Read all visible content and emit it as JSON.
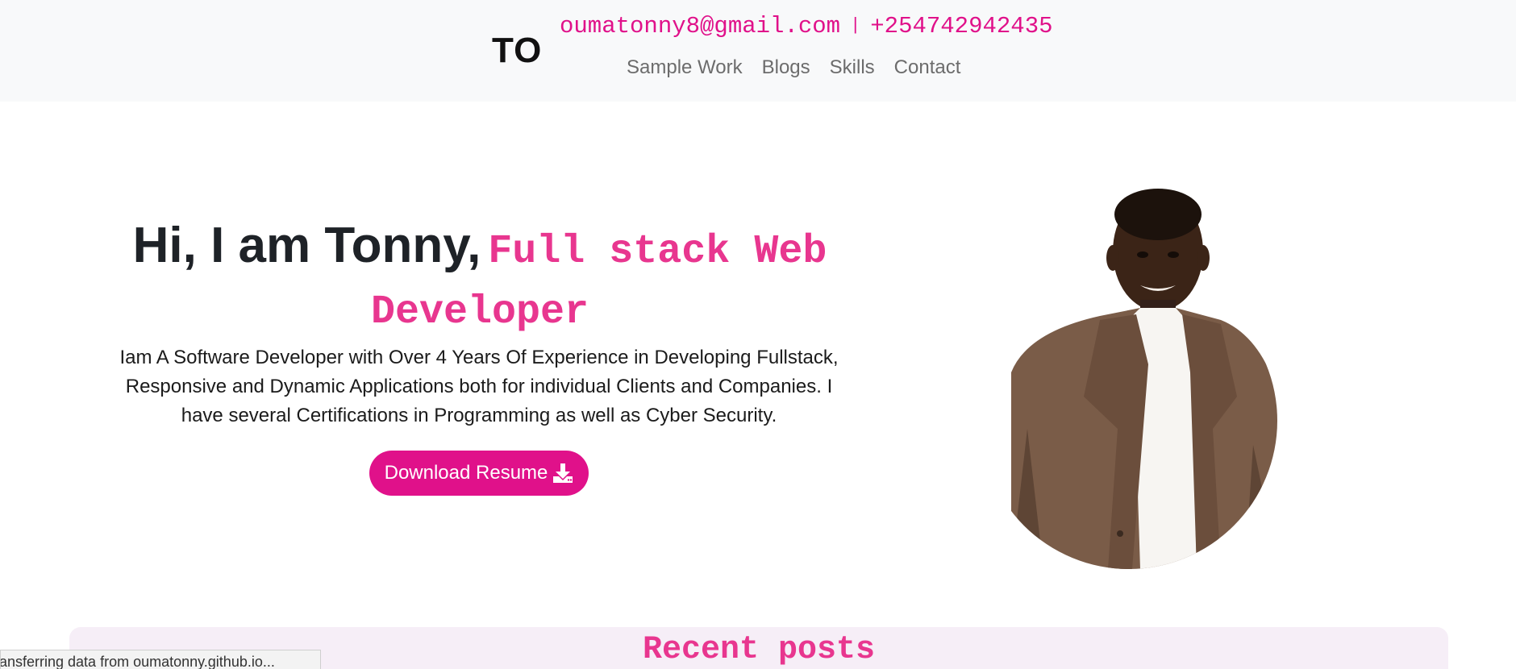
{
  "header": {
    "logo": "TO",
    "email": "oumatonny8@gmail.com",
    "separator": "|",
    "phone": "+254742942435",
    "nav": [
      {
        "label": "Sample Work"
      },
      {
        "label": "Blogs"
      },
      {
        "label": "Skills"
      },
      {
        "label": "Contact"
      }
    ]
  },
  "hero": {
    "greeting": "Hi, I am Tonny,",
    "role": "Full stack Web Developer",
    "description": "Iam A Software Developer with Over 4 Years Of Experience in Developing Fullstack, Responsive and Dynamic Applications both for individual Clients and Companies. I have several Certifications in Programming as well as Cyber Security.",
    "download_label": "Download Resume",
    "download_icon": "download-icon"
  },
  "portrait": {
    "icon": "profile-photo"
  },
  "posts": {
    "title": "Recent posts"
  },
  "status": {
    "text": "ransferring data from oumatonny.github.io..."
  },
  "colors": {
    "accent": "#e0118a",
    "accent_light": "#e8368f",
    "header_bg": "#f8f9fa",
    "posts_bg": "#f6eef7"
  }
}
